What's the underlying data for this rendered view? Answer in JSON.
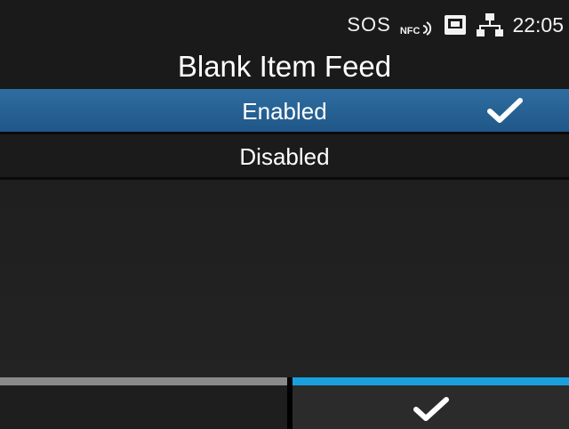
{
  "status_bar": {
    "sos_label": "SOS",
    "nfc_label": "NFC",
    "time": "22:05",
    "icons": [
      "nfc-icon",
      "sd-card-icon",
      "network-icon"
    ]
  },
  "title": "Blank Item Feed",
  "options": [
    {
      "label": "Enabled",
      "selected": true
    },
    {
      "label": "Disabled",
      "selected": false
    }
  ],
  "soft_keys": {
    "left": "",
    "right_icon": "check-icon"
  },
  "colors": {
    "selection": "#2a6699",
    "confirm_accent": "#1aa0dd",
    "back_accent": "#8a8a8a"
  }
}
